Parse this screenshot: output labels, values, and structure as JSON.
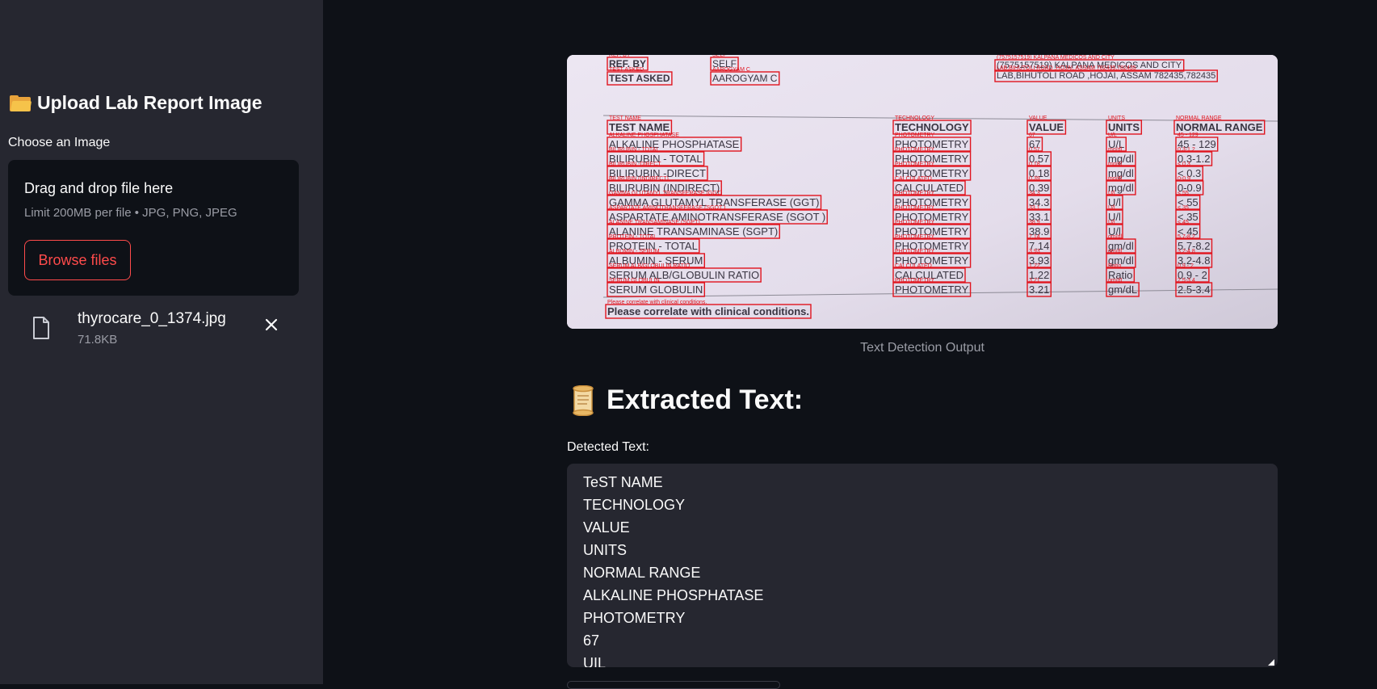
{
  "sidebar": {
    "header": "Upload Lab Report Image",
    "choose_label": "Choose an Image",
    "dropzone": {
      "title": "Drag and drop file here",
      "limit": "Limit 200MB per file • JPG, PNG, JPEG",
      "browse_label": "Browse files"
    },
    "file": {
      "name": "thyrocare_0_1374.jpg",
      "size": "71.8KB"
    }
  },
  "main": {
    "image_caption": "Text Detection Output",
    "section_title": "Extracted Text:",
    "textarea_label": "Detected Text:",
    "detected_lines": [
      "TeST NAME",
      "TECHNOLOGY",
      "VALUE",
      "UNITS",
      "NORMAL RANGE",
      "ALKALINE PHOSPHATASE",
      "PHOTOMETRY",
      "67",
      "UIL"
    ]
  },
  "report": {
    "header_rows": [
      {
        "label": "REF. BY",
        "value": "SELF"
      },
      {
        "label": "TEST ASKED",
        "value": "AAROGYAM C"
      }
    ],
    "address": [
      "(7575157519) KALPANA MEDICOS AND CITY",
      "LAB,BIHUTOLI ROAD ,HOJAI, ASSAM 782435,782435"
    ],
    "columns": [
      "TEST NAME",
      "TECHNOLOGY",
      "VALUE",
      "UNITS",
      "NORMAL RANGE"
    ],
    "rows": [
      [
        "ALKALINE PHOSPHATASE",
        "PHOTOMETRY",
        "67",
        "U/L",
        "45 - 129"
      ],
      [
        "BILIRUBIN - TOTAL",
        "PHOTOMETRY",
        "0.57",
        "mg/dl",
        "0.3-1.2"
      ],
      [
        "BILIRUBIN -DIRECT",
        "PHOTOMETRY",
        "0.18",
        "mg/dl",
        "< 0.3"
      ],
      [
        "BILIRUBIN (INDIRECT)",
        "CALCULATED",
        "0.39",
        "mg/dl",
        "0-0.9"
      ],
      [
        "GAMMA GLUTAMYL TRANSFERASE (GGT)",
        "PHOTOMETRY",
        "34.3",
        "U/l",
        "< 55"
      ],
      [
        "ASPARTATE AMINOTRANSFERASE (SGOT )",
        "PHOTOMETRY",
        "33.1",
        "U/l",
        "< 35"
      ],
      [
        "ALANINE TRANSAMINASE (SGPT)",
        "PHOTOMETRY",
        "38.9",
        "U/l",
        "< 45"
      ],
      [
        "PROTEIN - TOTAL",
        "PHOTOMETRY",
        "7.14",
        "gm/dl",
        "5.7-8.2"
      ],
      [
        "ALBUMIN - SERUM",
        "PHOTOMETRY",
        "3.93",
        "gm/dl",
        "3.2-4.8"
      ],
      [
        "SERUM ALB/GLOBULIN RATIO",
        "CALCULATED",
        "1.22",
        "Ratio",
        "0.9 - 2"
      ],
      [
        "SERUM GLOBULIN",
        "PHOTOMETRY",
        "3.21",
        "gm/dL",
        "2.5-3.4"
      ]
    ],
    "footer": "Please correlate with clinical conditions."
  },
  "colors": {
    "accent": "#ff4b4b",
    "sidebar_bg": "#262730",
    "main_bg": "#0e1117",
    "box": "#e0141e"
  }
}
